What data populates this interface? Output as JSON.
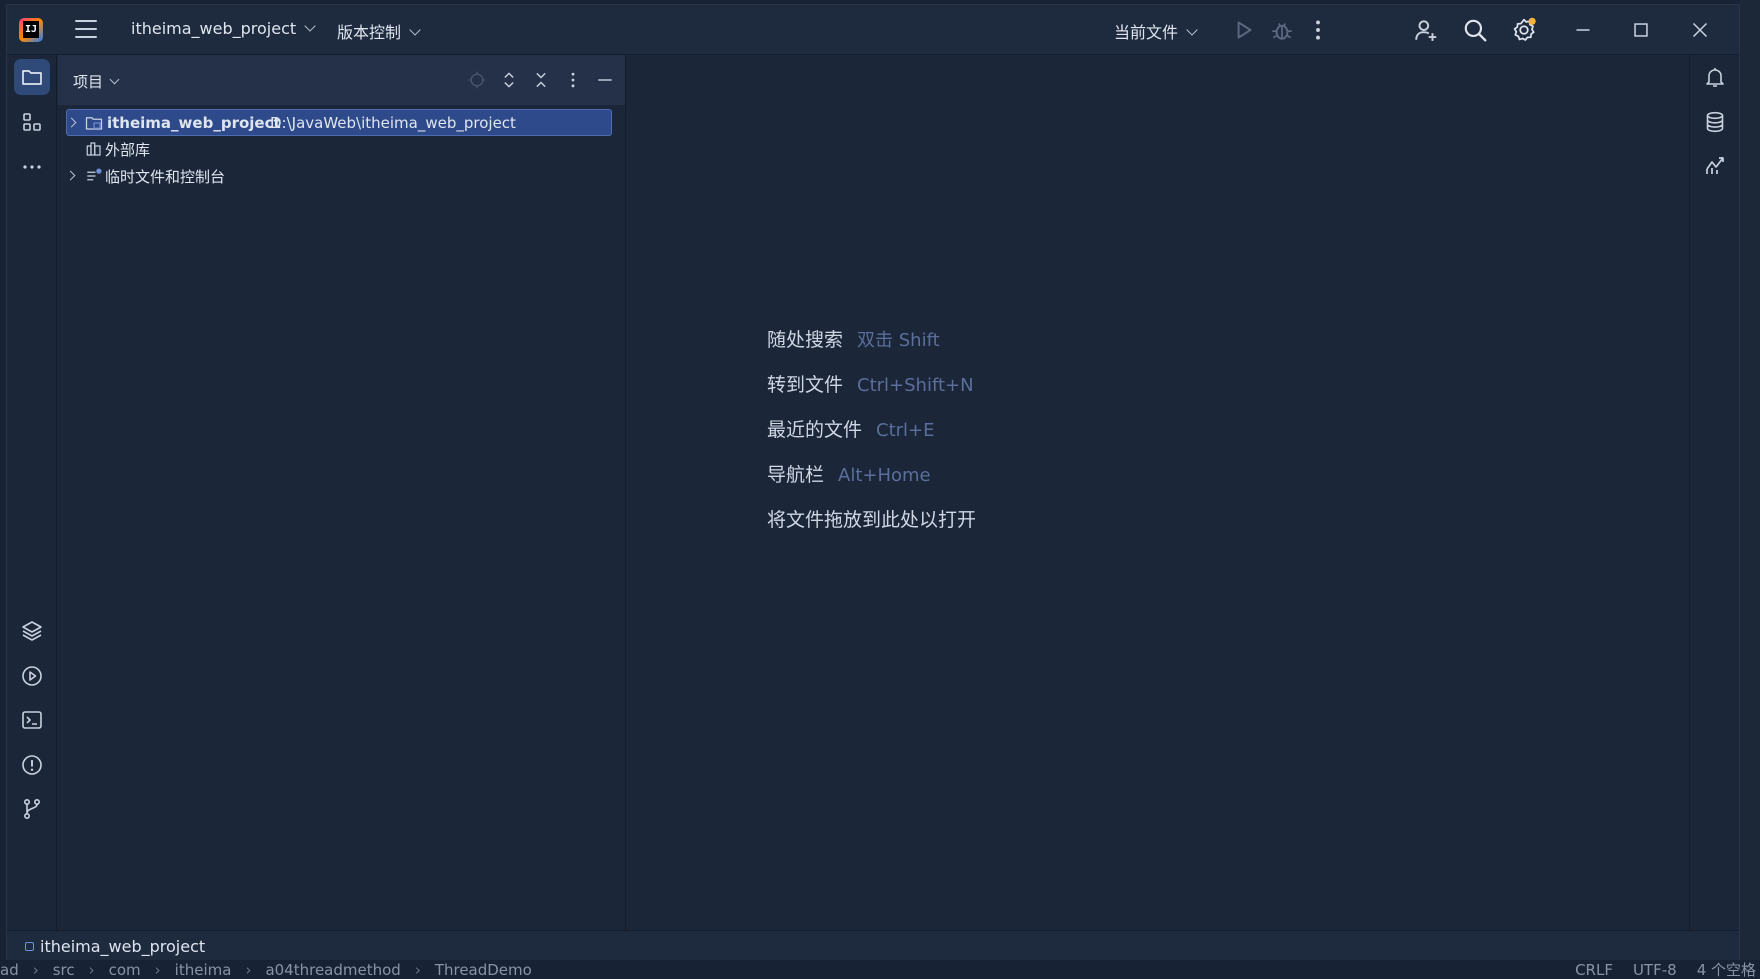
{
  "titlebar": {
    "project_name": "itheima_web_project",
    "vcs_label": "版本控制",
    "run_config": "当前文件",
    "icons": [
      "app-logo-icon",
      "hamburger-menu-icon",
      "run-icon",
      "debug-icon",
      "more-vertical-icon",
      "add-user-icon",
      "search-icon",
      "settings-icon",
      "minimize-icon",
      "maximize-icon",
      "close-icon"
    ]
  },
  "left_strip": {
    "icons": [
      "project-folder-icon",
      "structure-icon",
      "more-horizontal-icon",
      "layers-icon",
      "run-services-icon",
      "terminal-icon",
      "problems-icon",
      "git-branch-icon"
    ]
  },
  "right_strip": {
    "icons": [
      "notifications-bell-icon",
      "database-icon",
      "profiler-icon"
    ]
  },
  "project_panel": {
    "title": "项目",
    "tree": [
      {
        "label": "itheima_web_project",
        "path": "D:\\JavaWeb\\itheima_web_project",
        "selected": true,
        "expandable": true
      },
      {
        "label": "外部库",
        "path": "",
        "selected": false,
        "expandable": false
      },
      {
        "label": "临时文件和控制台",
        "path": "",
        "selected": false,
        "expandable": true
      }
    ]
  },
  "editor": {
    "hints": [
      {
        "label": "随处搜索",
        "shortcut": "双击 Shift"
      },
      {
        "label": "转到文件",
        "shortcut": "Ctrl+Shift+N"
      },
      {
        "label": "最近的文件",
        "shortcut": "Ctrl+E"
      },
      {
        "label": "导航栏",
        "shortcut": "Alt+Home"
      },
      {
        "label": "将文件拖放到此处以打开",
        "shortcut": ""
      }
    ]
  },
  "statusbar": {
    "module": "itheima_web_project"
  },
  "background_window": {
    "breadcrumbs": [
      "ad",
      "src",
      "com",
      "itheima",
      "a04threadmethod",
      "ThreadDemo"
    ],
    "status": [
      "CRLF",
      "UTF-8",
      "4 个空格"
    ]
  },
  "colors": {
    "window_bg": "#1b2638",
    "titlebar_bg": "#1e2a3e",
    "selection_bg": "#2f4a8a",
    "accent": "#2f4a78",
    "shortcut_text": "#5b6e9c"
  }
}
